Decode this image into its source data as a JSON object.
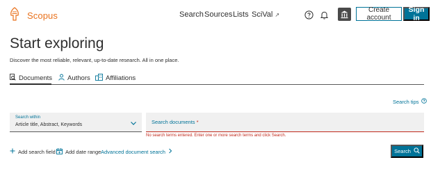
{
  "header": {
    "brand": "Scopus",
    "nav": {
      "search": "Search",
      "sources": "Sources",
      "lists": "Lists",
      "scival": "SciVal"
    },
    "icons": {
      "scival_external": "external-link-icon",
      "help": "help-icon",
      "notifications": "bell-icon",
      "institution": "institution-icon"
    },
    "create_account": "Create account",
    "sign_in": "Sign in"
  },
  "main": {
    "title": "Start exploring",
    "subtitle": "Discover the most reliable, relevant, up-to-date research. All in one place.",
    "tabs": [
      {
        "label": "Documents",
        "icon": "document-search-icon",
        "active": true
      },
      {
        "label": "Authors",
        "icon": "person-icon",
        "active": false
      },
      {
        "label": "Affiliations",
        "icon": "building-icon",
        "active": false
      }
    ],
    "search_tips": "Search tips",
    "search_within": {
      "label": "Search within",
      "value": "Article title, Abstract, Keywords"
    },
    "documents_field": {
      "placeholder": "Search documents",
      "required_marker": "*",
      "value": ""
    },
    "error": "No search terms entered. Enter one or more search terms and click Search.",
    "actions": {
      "add_search_field": "Add search field",
      "add_date_range": "Add date range",
      "advanced_search": "Advanced document search"
    },
    "search_button": "Search"
  },
  "colors": {
    "brand_orange": "#e9711c",
    "primary_blue": "#007398",
    "error_red": "#c0281b"
  }
}
